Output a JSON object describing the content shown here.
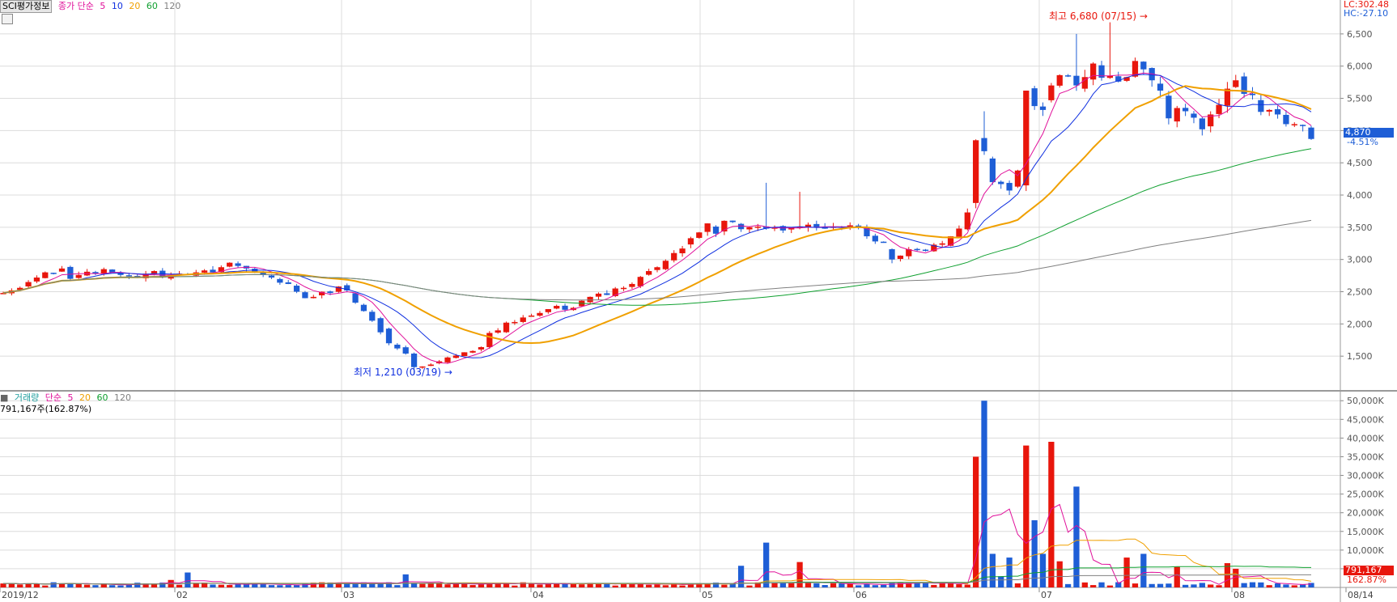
{
  "header": {
    "stock_name": "SCI평가정보",
    "ma_legend": [
      {
        "label": "종가 단순",
        "color": "#e0109a"
      },
      {
        "label": "5",
        "color": "#e0109a"
      },
      {
        "label": "10",
        "color": "#1030e0"
      },
      {
        "label": "20",
        "color": "#f0a000"
      },
      {
        "label": "60",
        "color": "#10a030"
      },
      {
        "label": "120",
        "color": "#808080"
      }
    ],
    "lc": "LC:302.48",
    "hc": "HC:-27.10",
    "current_price": "4,870",
    "change_pct": "-4.51%",
    "high_note": "최고 6,680 (07/15)",
    "low_note": "최저 1,210 (03/19)"
  },
  "volume_header": {
    "title": "거래량",
    "ma_legend": [
      {
        "label": "단순",
        "color": "#e0109a"
      },
      {
        "label": "5",
        "color": "#e0109a"
      },
      {
        "label": "20",
        "color": "#f0a000"
      },
      {
        "label": "60",
        "color": "#10a030"
      },
      {
        "label": "120",
        "color": "#808080"
      }
    ],
    "current": "791,167주(162.87%)",
    "box_value": "791,167",
    "box_pct": "162.87%"
  },
  "chart_data": {
    "type": "candlestick",
    "x_tick_labels": [
      "2019/12",
      "02",
      "03",
      "04",
      "05",
      "06",
      "07",
      "08",
      "08/14"
    ],
    "price_axis": {
      "ticks": [
        1500,
        2000,
        2500,
        3000,
        3500,
        4000,
        4500,
        5000,
        5500,
        6000,
        6500
      ],
      "labels": [
        "1,500",
        "2,000",
        "2,500",
        "3,000",
        "3,500",
        "4,000",
        "4,500",
        "5,000",
        "5,500",
        "6,000",
        "6,500"
      ],
      "ylim": [
        1000,
        6800
      ]
    },
    "volume_axis": {
      "ticks": [
        5000,
        10000,
        15000,
        20000,
        25000,
        30000,
        35000,
        40000,
        45000,
        50000
      ],
      "labels": [
        "5,000K",
        "10,000K",
        "15,000K",
        "20,000K",
        "25,000K",
        "30,000K",
        "35,000K",
        "40,000K",
        "45,000K",
        "50,000K"
      ],
      "ylim": [
        0,
        52000
      ]
    },
    "series": {
      "close": [
        2480,
        2520,
        2560,
        2650,
        2720,
        2800,
        2780,
        2860,
        2700,
        2760,
        2810,
        2780,
        2850,
        2800,
        2760,
        2740,
        2720,
        2780,
        2820,
        2720,
        2760,
        2780,
        2760,
        2800,
        2830,
        2800,
        2880,
        2950,
        2900,
        2860,
        2800,
        2760,
        2720,
        2640,
        2620,
        2500,
        2400,
        2420,
        2500,
        2480,
        2580,
        2520,
        2330,
        2200,
        2050,
        1870,
        1700,
        1620,
        1540,
        1330,
        1340,
        1370,
        1420,
        1480,
        1510,
        1560,
        1580,
        1640,
        1860,
        1900,
        2020,
        2030,
        2100,
        2130,
        2170,
        2230,
        2280,
        2220,
        2250,
        2360,
        2420,
        2470,
        2450,
        2550,
        2560,
        2620,
        2730,
        2820,
        2880,
        2980,
        3100,
        3170,
        3330,
        3420,
        3560,
        3400,
        3600,
        3580,
        3470,
        3500,
        3510,
        3480,
        3500,
        3450,
        3500,
        3510,
        3540,
        3500,
        3490,
        3510,
        3500,
        3530,
        3490,
        3360,
        3280,
        3260,
        3000,
        3060,
        3160,
        3150,
        3140,
        3230,
        3250,
        3360,
        3480,
        3730,
        4850,
        4680,
        4200,
        4170,
        4070,
        4380,
        5620,
        5380,
        5320,
        5700,
        5860,
        5850,
        5700,
        5830,
        6040,
        5820,
        5850,
        5760,
        5830,
        6080,
        5950,
        5780,
        5620,
        5190,
        5350,
        5300,
        5200,
        5020,
        5250,
        5400,
        5650,
        5780,
        5570,
        5550,
        5290,
        5320,
        5250,
        5100,
        5100,
        5070,
        4870
      ]
    },
    "high_marker": {
      "value": 6680,
      "date": "07/15"
    },
    "low_marker": {
      "value": 1210,
      "date": "03/19"
    },
    "volume_peaks_k": [
      50000,
      38000,
      39000,
      35000,
      27000
    ],
    "colors": {
      "up": "#e8160c",
      "down": "#1e5ed6",
      "ma5": "#e0109a",
      "ma10": "#1030e0",
      "ma20": "#f0a000",
      "ma60": "#10a030",
      "ma120": "#808080"
    }
  }
}
